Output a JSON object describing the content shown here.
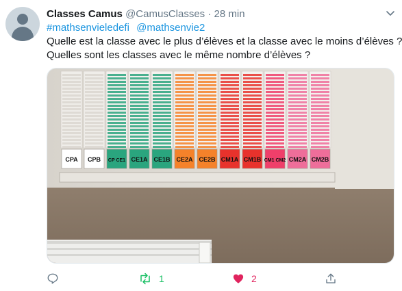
{
  "tweet": {
    "author_name": "Classes Camus",
    "author_handle": "@CamusClasses",
    "separator": "·",
    "time": "28 min",
    "hashtags": [
      "#mathsenvieledefi",
      "@mathsenvie2"
    ],
    "lines": [
      "Quelle est la classe avec le plus d’élèves et la classe avec le moins d’élèves ?",
      "Quelles sont les classes avec le même nombre d’élèves ?"
    ]
  },
  "media": {
    "labels": [
      "CPA",
      "CPB",
      "CP CE1",
      "CE1A",
      "CE1B",
      "CE2A",
      "CE2B",
      "CM1A",
      "CM1B",
      "CM1 CM2",
      "CM2A",
      "CM2B"
    ],
    "colors": [
      "#ffffff",
      "#ffffff",
      "#2aa57e",
      "#2aa57e",
      "#2aa57e",
      "#f5822a",
      "#f5822a",
      "#e8322c",
      "#e8322c",
      "#ef3f6a",
      "#ee6e9a",
      "#ee6e9a"
    ]
  },
  "actions": {
    "reply_count": "",
    "retweet_count": "1",
    "like_count": "2",
    "colors": {
      "retweet": "#17bf63",
      "like": "#e0245e",
      "neutral": "#657786"
    },
    "icons": [
      "reply-icon",
      "retweet-icon",
      "like-icon",
      "share-icon"
    ]
  }
}
